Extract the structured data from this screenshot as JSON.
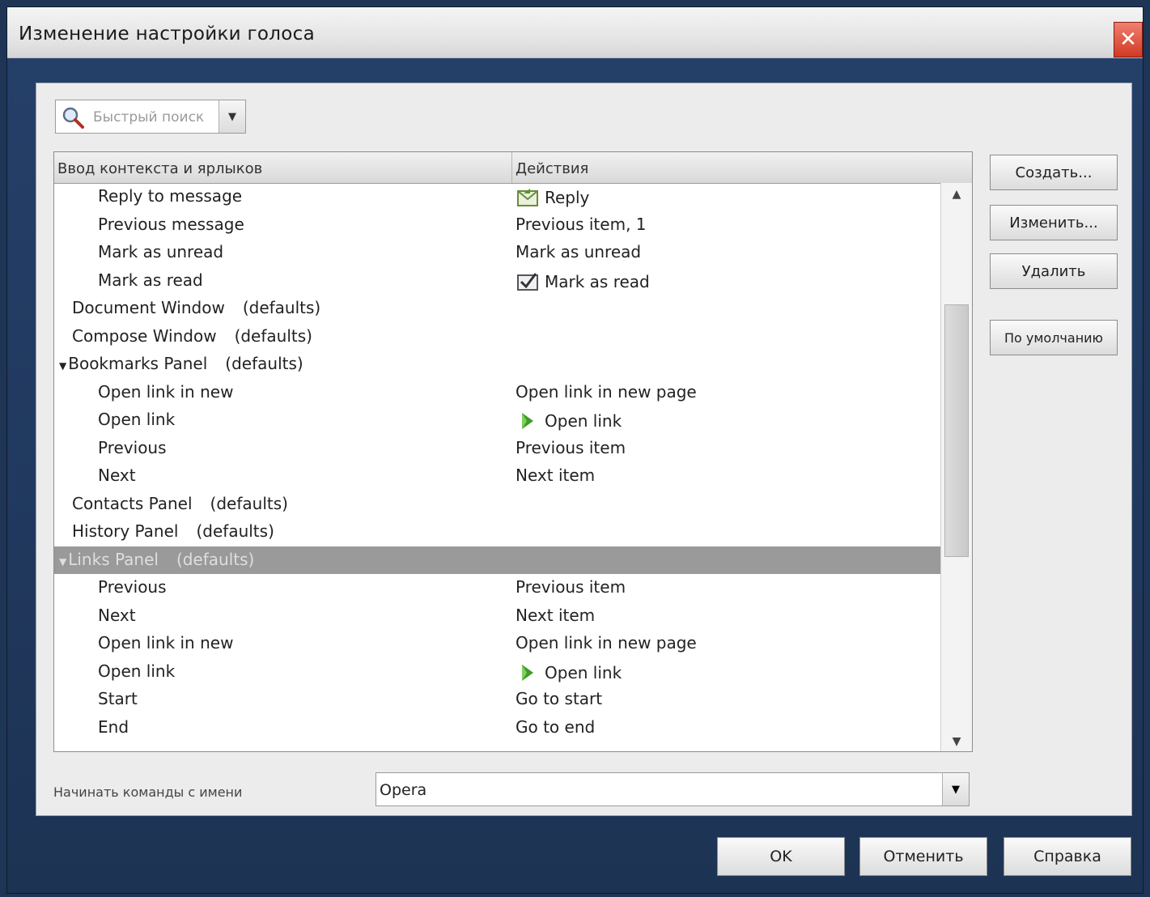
{
  "window": {
    "title": "Изменение настройки голоса"
  },
  "search": {
    "placeholder": "Быстрый поиск"
  },
  "tree": {
    "columns": [
      "Ввод контекста и ярлыков",
      "Действия"
    ],
    "rows": [
      {
        "label": "Reply to message",
        "level": 2,
        "action": "Reply",
        "action_icon": "reply-icon"
      },
      {
        "label": "Previous message",
        "level": 2,
        "action": "Previous item, 1"
      },
      {
        "label": "Mark as unread",
        "level": 2,
        "action": "Mark as unread"
      },
      {
        "label": "Mark as read",
        "level": 2,
        "action": "Mark as read",
        "action_icon": "mark-read-icon"
      },
      {
        "label": "Document Window",
        "level": 1,
        "suffix": "(defaults)"
      },
      {
        "label": "Compose Window",
        "level": 1,
        "suffix": "(defaults)"
      },
      {
        "label": "Bookmarks Panel",
        "level": 1,
        "suffix": "(defaults)",
        "expanded": true
      },
      {
        "label": "Open link in new",
        "level": 2,
        "action": "Open link in new page"
      },
      {
        "label": "Open link",
        "level": 2,
        "action": "Open link",
        "action_icon": "open-link-icon"
      },
      {
        "label": "Previous",
        "level": 2,
        "action": "Previous item"
      },
      {
        "label": "Next",
        "level": 2,
        "action": "Next item"
      },
      {
        "label": "Contacts Panel",
        "level": 1,
        "suffix": "(defaults)"
      },
      {
        "label": "History Panel",
        "level": 1,
        "suffix": "(defaults)"
      },
      {
        "label": "Links Panel",
        "level": 1,
        "suffix": "(defaults)",
        "expanded": true,
        "selected": true
      },
      {
        "label": "Previous",
        "level": 2,
        "action": "Previous item"
      },
      {
        "label": "Next",
        "level": 2,
        "action": "Next item"
      },
      {
        "label": "Open link in new",
        "level": 2,
        "action": "Open link in new page"
      },
      {
        "label": "Open link",
        "level": 2,
        "action": "Open link",
        "action_icon": "open-link-icon"
      },
      {
        "label": "Start",
        "level": 2,
        "action": "Go to start"
      },
      {
        "label": "End",
        "level": 2,
        "action": "Go to end"
      }
    ]
  },
  "side_buttons": {
    "create": "Создать...",
    "edit": "Изменить...",
    "delete": "Удалить",
    "defaults": "По умолчанию"
  },
  "command_prefix": {
    "label": "Начинать команды с имени",
    "value": "Opera"
  },
  "footer": {
    "ok": "OK",
    "cancel": "Отменить",
    "help": "Справка"
  },
  "colors": {
    "titlebar": "#e3e3e3",
    "close": "#d03a24",
    "frame": "#1f3556",
    "selected_row": "#9a9a9a"
  }
}
